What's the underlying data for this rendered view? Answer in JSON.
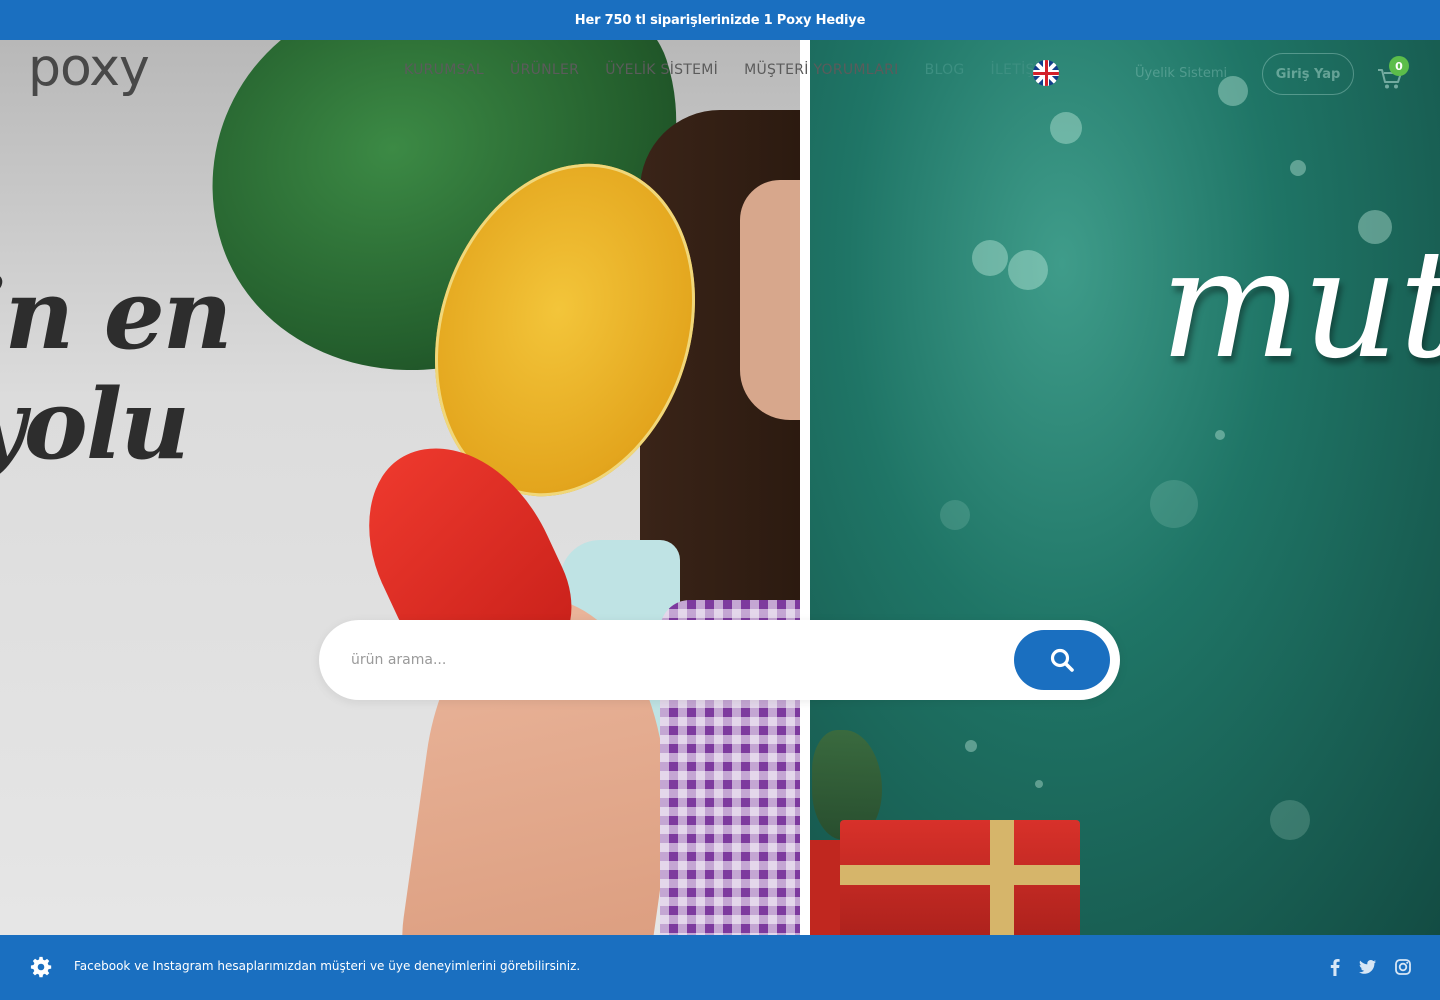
{
  "announcement": {
    "text": "Her 750 tl siparişlerinizde 1 Poxy Hediye"
  },
  "brand": {
    "logo_text": "poxy",
    "accent": "#1a6fc0",
    "badge_color": "#5cbd4a"
  },
  "nav": {
    "items": [
      {
        "label": "KURUMSAL"
      },
      {
        "label": "ÜRÜNLER"
      },
      {
        "label": "ÜYELİK SİSTEMİ"
      },
      {
        "label": "MÜŞTERİ YORUMLARI"
      },
      {
        "label": "BLOG"
      },
      {
        "label": "İLETİŞİM"
      }
    ],
    "language_icon": "uk-flag-icon",
    "member_link": "Üyelik Sistemi",
    "login_label": "Giriş Yap",
    "cart_icon": "cart-icon",
    "cart_count": "0"
  },
  "hero": {
    "left_script_line1": "in en",
    "left_script_line2": "yolu",
    "right_script": "mut"
  },
  "search": {
    "placeholder": "ürün arama...",
    "button_icon": "search-icon"
  },
  "footer_bar": {
    "settings_icon": "gear-icon",
    "text": "Facebook ve Instagram hesaplarımızdan müşteri ve üye deneyimlerini görebilirsiniz.",
    "social_icons": [
      "facebook-icon",
      "twitter-icon",
      "instagram-icon"
    ]
  }
}
